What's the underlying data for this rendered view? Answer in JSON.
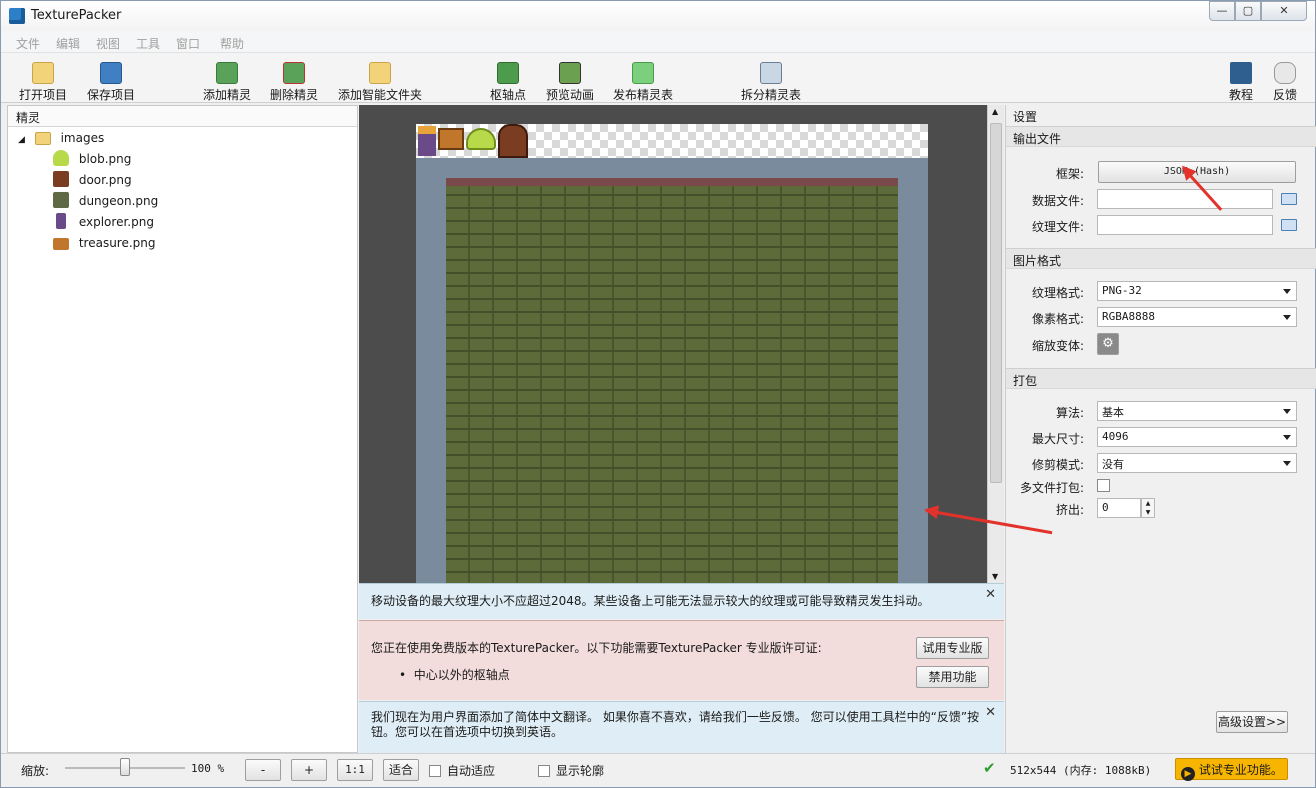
{
  "window": {
    "title": "TexturePacker"
  },
  "menu": [
    "文件",
    "编辑",
    "视图",
    "工具",
    "窗口",
    "帮助"
  ],
  "toolbar": {
    "open": "打开项目",
    "save": "保存项目",
    "add_sprite": "添加精灵",
    "remove_sprite": "删除精灵",
    "add_smart_folder": "添加智能文件夹",
    "pivot": "枢轴点",
    "preview_anim": "预览动画",
    "publish": "发布精灵表",
    "split": "拆分精灵表",
    "tutorial": "教程",
    "feedback": "反馈"
  },
  "sprites_panel": {
    "header": "精灵",
    "folder": "images",
    "files": [
      "blob.png",
      "door.png",
      "dungeon.png",
      "explorer.png",
      "treasure.png"
    ]
  },
  "notices": {
    "mobile": "移动设备的最大纹理大小不应超过2048。某些设备上可能无法显示较大的纹理或可能导致精灵发生抖动。",
    "license_text": "您正在使用免费版本的TexturePacker。以下功能需要TexturePacker 专业版许可证:",
    "license_item": "中心以外的枢轴点",
    "try_pro": "试用专业版",
    "disable_feature": "禁用功能",
    "translation": "我们现在为用户界面添加了简体中文翻译。 如果你喜不喜欢，请给我们一些反馈。 您可以使用工具栏中的“反馈”按钮。您可以在首选项中切换到英语。"
  },
  "settings": {
    "header": "设置",
    "output_section": "输出文件",
    "framework_label": "框架:",
    "framework_value": "JSON (Hash)",
    "data_file_label": "数据文件:",
    "data_file_value": "",
    "texture_file_label": "纹理文件:",
    "texture_file_value": "",
    "image_format_section": "图片格式",
    "texture_format_label": "纹理格式:",
    "texture_format_value": "PNG-32",
    "pixel_format_label": "像素格式:",
    "pixel_format_value": "RGBA8888",
    "scale_variant_label": "缩放变体:",
    "packing_section": "打包",
    "algorithm_label": "算法:",
    "algorithm_value": "基本",
    "max_size_label": "最大尺寸:",
    "max_size_value": "4096",
    "trim_label": "修剪模式:",
    "trim_value": "没有",
    "multipack_label": "多文件打包:",
    "multipack_checked": false,
    "extrude_label": "挤出:",
    "extrude_value": "0",
    "advanced_button": "高级设置>>"
  },
  "statusbar": {
    "zoom_label": "缩放:",
    "zoom_value": "100 %",
    "zoom_fraction": 0.5,
    "minus": "-",
    "plus": "+",
    "one_to_one": "1:1",
    "fit": "适合",
    "auto_fit": "自动适应",
    "show_outline": "显示轮廓",
    "size_info": "512x544 (内存: 1088kB)",
    "try_pro": "试试专业功能。"
  },
  "colors": {
    "accent_orange": "#f7b500",
    "annotation_red": "#e3322b"
  }
}
